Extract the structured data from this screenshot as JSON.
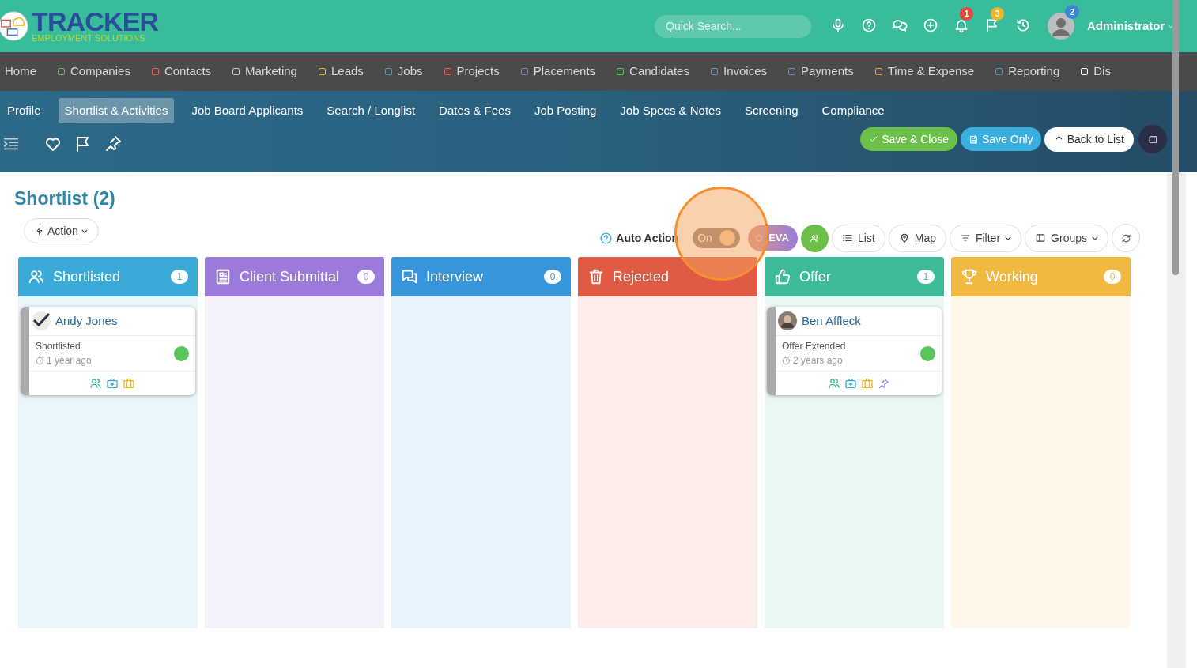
{
  "header": {
    "logo_title": "TRACKER",
    "logo_subtitle": "EMPLOYMENT SOLUTIONS",
    "search": {
      "placeholder": "Quick Search..."
    },
    "icon_badges": [
      {
        "kind": "mic"
      },
      {
        "kind": "help"
      },
      {
        "kind": "chat"
      },
      {
        "kind": "add"
      },
      {
        "kind": "bell",
        "badge": "1",
        "color": "#e04a3a"
      },
      {
        "kind": "flag",
        "badge": "3",
        "color": "#f0b429"
      },
      {
        "kind": "history"
      }
    ],
    "user": {
      "badge": "2",
      "name": "Administrator"
    }
  },
  "main_nav": [
    {
      "label": "Home"
    },
    {
      "label": "Companies",
      "color": "#5cc45c"
    },
    {
      "label": "Contacts",
      "color": "#e8604c"
    },
    {
      "label": "Marketing",
      "color": "#cccccc"
    },
    {
      "label": "Leads",
      "color": "#f0b429"
    },
    {
      "label": "Jobs",
      "color": "#3aa0d8"
    },
    {
      "label": "Projects",
      "color": "#e8604c"
    },
    {
      "label": "Placements",
      "color": "#9b6fd8"
    },
    {
      "label": "Candidates",
      "color": "#5cc45c"
    },
    {
      "label": "Invoices",
      "color": "#6a8fe0"
    },
    {
      "label": "Payments",
      "color": "#6a8fe0"
    },
    {
      "label": "Time & Expense",
      "color": "#f0a040"
    },
    {
      "label": "Reporting",
      "color": "#3aa0d8"
    },
    {
      "label": "Dis",
      "color": "#ffffff"
    }
  ],
  "sub_tabs": [
    {
      "label": "Profile",
      "selected": false
    },
    {
      "label": "Shortlist & Activities",
      "selected": true
    },
    {
      "label": "Job Board Applicants",
      "selected": false
    },
    {
      "label": "Search / Longlist",
      "selected": false
    },
    {
      "label": "Dates & Fees",
      "selected": false
    },
    {
      "label": "Job Posting",
      "selected": false
    },
    {
      "label": "Job Specs & Notes",
      "selected": false
    },
    {
      "label": "Screening",
      "selected": false
    },
    {
      "label": "Compliance",
      "selected": false
    }
  ],
  "record_buttons": [
    "Save & Close",
    "Save Only",
    "Back to List"
  ],
  "page_title": "Shortlist (2)",
  "action_button": "Action",
  "auto_action": {
    "label": "Auto Action",
    "on": true,
    "toggle_text": "On"
  },
  "view_buttons": [
    {
      "kind": "eva",
      "label": "EVA"
    },
    {
      "kind": "people"
    },
    {
      "kind": "list",
      "label": "List"
    },
    {
      "kind": "map",
      "label": "Map"
    },
    {
      "kind": "filter",
      "label": "Filter"
    },
    {
      "kind": "groups",
      "label": "Groups"
    },
    {
      "kind": "refresh"
    }
  ],
  "columns": [
    {
      "title": "Shortlisted",
      "count": "1",
      "color": "#3aabd8",
      "cards": [
        {
          "name": "Andy Jones",
          "status": "Shortlisted",
          "time": "1 year ago",
          "color": "#5cc45c",
          "pinned": false
        }
      ]
    },
    {
      "title": "Client Submittal",
      "count": "0",
      "color": "#9b7bd9"
    },
    {
      "title": "Interview",
      "count": "0",
      "color": "#3795db"
    },
    {
      "title": "Rejected",
      "color": "#e05a44"
    },
    {
      "title": "Offer",
      "count": "1",
      "color": "#3dbb98",
      "cards": [
        {
          "name": "Ben Affleck",
          "status": "Offer Extended",
          "time": "2 years ago",
          "color": "#5cc45c",
          "pinned": true
        }
      ]
    },
    {
      "title": "Working",
      "count": "0",
      "color": "#f2b940"
    }
  ]
}
